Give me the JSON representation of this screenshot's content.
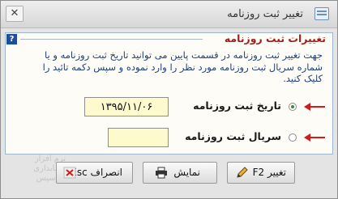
{
  "window": {
    "title": "تغییر ثبت روزنامه"
  },
  "panel": {
    "title": "تغییرات ثبت روزنامه",
    "description": "جهت تغییر ثبت روزنامه در قسمت پایین می توانید تاریخ ثبت روزنامه و یا شماره سریال ثبت روزنامه مورد نظر را وارد نموده و سپس دکمه تائید را کلیک کنید."
  },
  "options": [
    {
      "label": "تاریخ ثبت روزنامه",
      "value": "۱۳۹۵/۱۱/۰۶",
      "selected": true
    },
    {
      "label": "سریال ثبت روزنامه",
      "value": "",
      "selected": false
    }
  ],
  "buttons": {
    "change_label": "تغییر F2",
    "show_label": "نمایش",
    "cancel_label": "انصراف Esc"
  },
  "colors": {
    "accent_arrow": "#d11c1c",
    "title_red": "#a02020",
    "description_blue": "#1f3f7a",
    "field_yellow": "#fdfbce"
  }
}
